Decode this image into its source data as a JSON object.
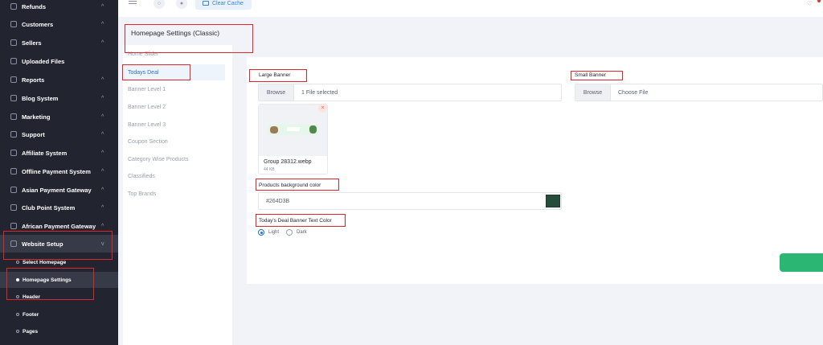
{
  "sidebar": {
    "items": [
      {
        "label": "Refunds"
      },
      {
        "label": "Customers"
      },
      {
        "label": "Sellers"
      },
      {
        "label": "Uploaded Files"
      },
      {
        "label": "Reports"
      },
      {
        "label": "Blog System"
      },
      {
        "label": "Marketing"
      },
      {
        "label": "Support"
      },
      {
        "label": "Affiliate System"
      },
      {
        "label": "Offline Payment System"
      },
      {
        "label": "Asian Payment Gateway"
      },
      {
        "label": "Club Point System"
      },
      {
        "label": "African Payment Gateway"
      },
      {
        "label": "Website Setup"
      }
    ],
    "subitems": [
      {
        "label": "Select Homepage"
      },
      {
        "label": "Homepage Settings"
      },
      {
        "label": "Header"
      },
      {
        "label": "Footer"
      },
      {
        "label": "Pages"
      }
    ]
  },
  "topbar": {
    "clear_cache": "Clear Cache"
  },
  "page": {
    "title": "Homepage Settings (Classic)"
  },
  "settings_nav": [
    {
      "label": "Home Slider"
    },
    {
      "label": "Todays Deal"
    },
    {
      "label": "Banner Level 1"
    },
    {
      "label": "Banner Level 2"
    },
    {
      "label": "Banner Level 3"
    },
    {
      "label": "Coupon Section"
    },
    {
      "label": "Category Wise Products"
    },
    {
      "label": "Classifieds"
    },
    {
      "label": "Top Brands"
    }
  ],
  "form": {
    "large_banner": {
      "label": "Large Banner",
      "browse": "Browse",
      "value": "1 File selected",
      "file_name": "Group 28312.webp",
      "file_size": "44 KB"
    },
    "small_banner": {
      "label": "Small Banner",
      "browse": "Browse",
      "placeholder": "Choose File"
    },
    "products_bg_color": {
      "label": "Products background color",
      "value": "#264D3B"
    },
    "text_color": {
      "label": "Today's Deal Banner Text Color",
      "options": [
        {
          "label": "Light",
          "selected": true
        },
        {
          "label": "Dark",
          "selected": false
        }
      ]
    }
  },
  "colors": {
    "sidebar_bg": "#22252f",
    "accent": "#2e6fc7",
    "save_button": "#2bb673",
    "annotation": "#e0252b"
  }
}
